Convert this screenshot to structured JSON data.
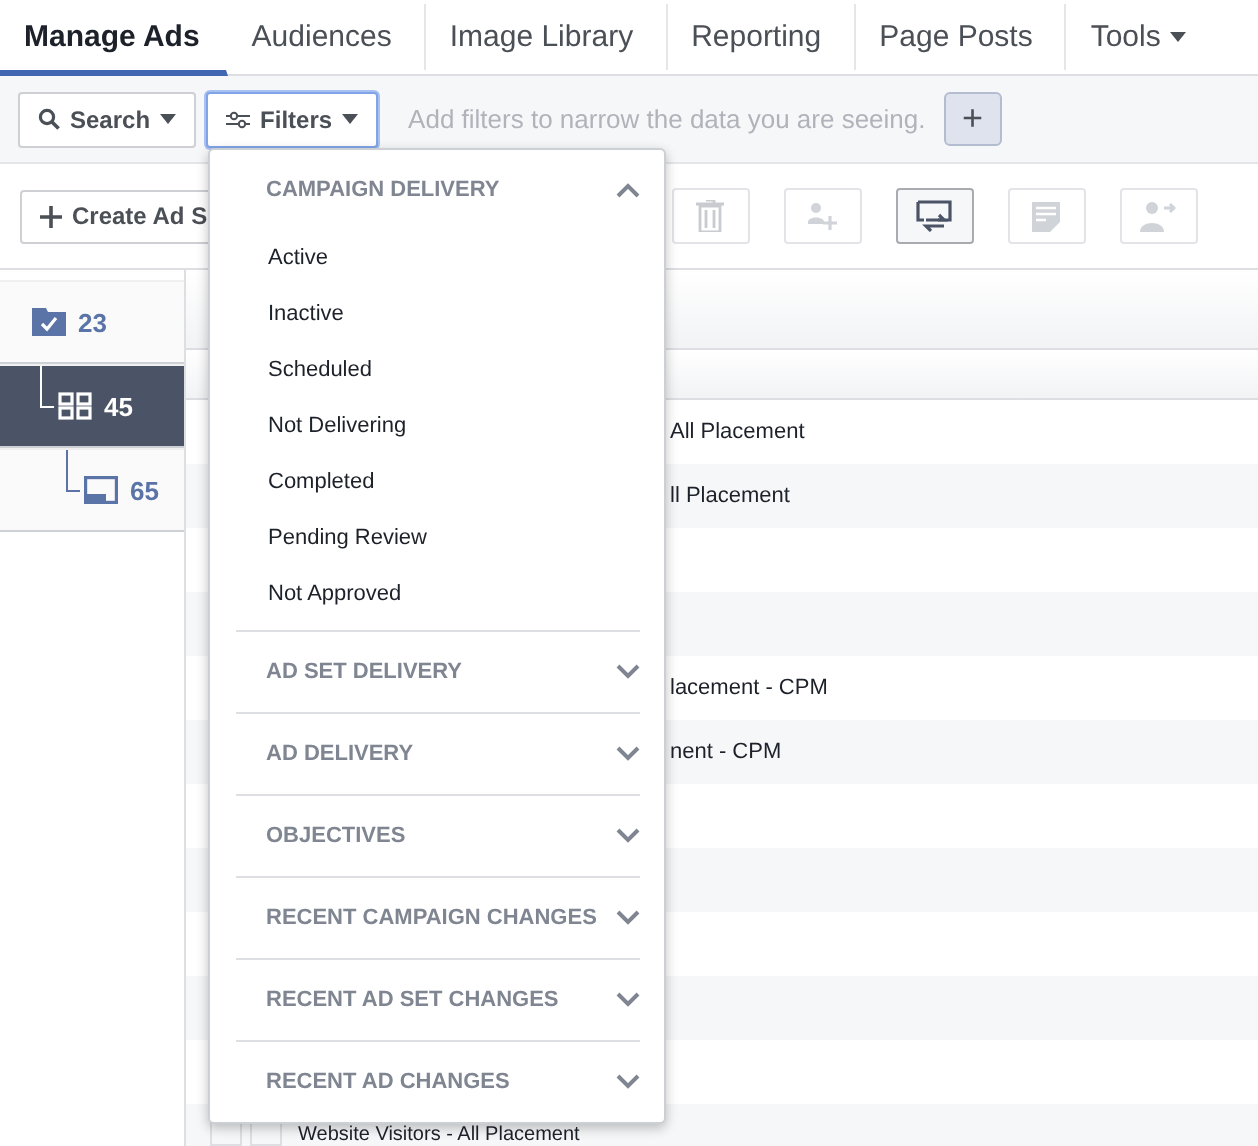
{
  "tabs": [
    {
      "label": "Manage Ads",
      "selected": true,
      "dropdown": false
    },
    {
      "label": "Audiences",
      "selected": false,
      "dropdown": false
    },
    {
      "label": "Image Library",
      "selected": false,
      "dropdown": false
    },
    {
      "label": "Reporting",
      "selected": false,
      "dropdown": false
    },
    {
      "label": "Page Posts",
      "selected": false,
      "dropdown": false
    },
    {
      "label": "Tools",
      "selected": false,
      "dropdown": true
    }
  ],
  "filter_bar": {
    "search_button": "Search",
    "filters_button": {
      "label": "Filters",
      "open": true
    },
    "hint": "Add filters to narrow the data you are seeing.",
    "add_button": "+"
  },
  "actions": {
    "create_button": "Create Ad S",
    "icon_buttons": [
      {
        "kind": "trash",
        "selected": false
      },
      {
        "kind": "person-plus",
        "selected": false
      },
      {
        "kind": "swap",
        "selected": true
      },
      {
        "kind": "note",
        "selected": false
      },
      {
        "kind": "person-arrow",
        "selected": false
      }
    ]
  },
  "tree": [
    {
      "kind": "campaign",
      "count": "23",
      "selected": false,
      "children": [
        {
          "kind": "adset",
          "count": "45",
          "selected": true,
          "children": [
            {
              "kind": "ad",
              "count": "65",
              "selected": false
            }
          ]
        }
      ]
    }
  ],
  "table": {
    "rows": [
      {
        "text": "All Placement"
      },
      {
        "text": "ll Placement"
      },
      {},
      {},
      {
        "text": "lacement - CPM"
      },
      {
        "text": "nent - CPM"
      },
      {},
      {},
      {},
      {},
      {}
    ],
    "bottom_row": {
      "text": "Website Visitors - All Placement"
    }
  },
  "filter_menu": {
    "sections": [
      {
        "title": "CAMPAIGN DELIVERY",
        "expanded": true,
        "options": [
          "Active",
          "Inactive",
          "Scheduled",
          "Not Delivering",
          "Completed",
          "Pending Review",
          "Not Approved"
        ]
      },
      {
        "title": "AD SET DELIVERY",
        "expanded": false
      },
      {
        "title": "AD DELIVERY",
        "expanded": false
      },
      {
        "title": "OBJECTIVES",
        "expanded": false
      },
      {
        "title": "RECENT CAMPAIGN CHANGES",
        "expanded": false
      },
      {
        "title": "RECENT AD SET CHANGES",
        "expanded": false
      },
      {
        "title": "RECENT AD CHANGES",
        "expanded": false
      }
    ]
  }
}
